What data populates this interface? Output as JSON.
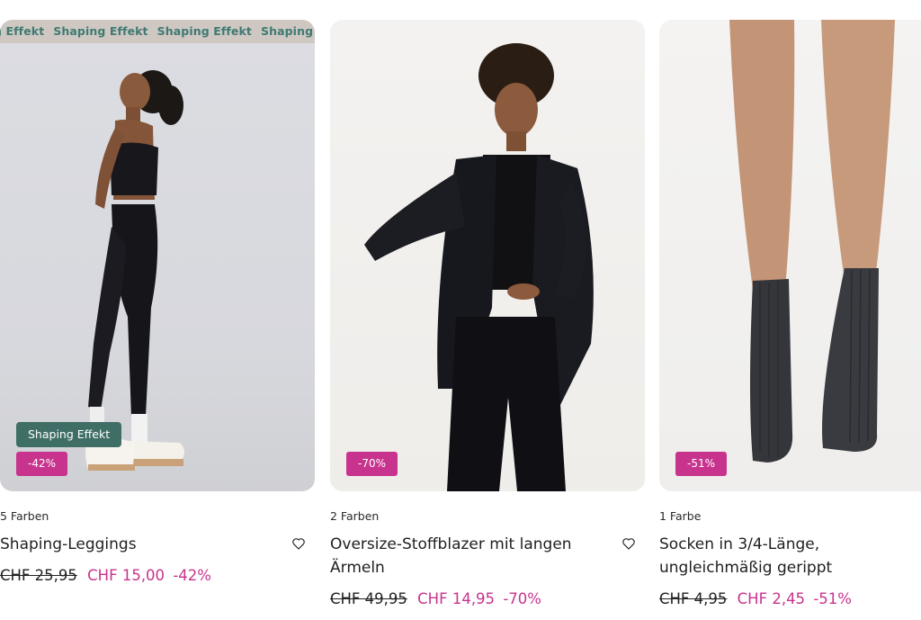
{
  "products": [
    {
      "ticker": [
        "g Effekt",
        "Shaping Effekt",
        "Shaping Effekt",
        "Shaping Effekt"
      ],
      "tag": "Shaping Effekt",
      "badge": "-42%",
      "colors": "5 Farben",
      "title": "Shaping-Leggings",
      "old_price": "CHF 25,95",
      "new_price": "CHF 15,00",
      "discount": "-42%"
    },
    {
      "badge": "-70%",
      "colors": "2 Farben",
      "title": "Oversize-Stoffblazer mit langen Ärmeln",
      "old_price": "CHF 49,95",
      "new_price": "CHF 14,95",
      "discount": "-70%"
    },
    {
      "badge": "-51%",
      "colors": "1 Farbe",
      "title": "Socken in 3/4-Länge, ungleichmäßig gerippt",
      "old_price": "CHF 4,95",
      "new_price": "CHF 2,45",
      "discount": "-51%"
    }
  ],
  "icons": {
    "wishlist": "heart-outline-icon"
  },
  "colors": {
    "sale": "#c8338d",
    "tag_bg": "#3e6e66",
    "ticker_text": "#3f7a72",
    "ticker_bg": "#cfc8c2"
  }
}
